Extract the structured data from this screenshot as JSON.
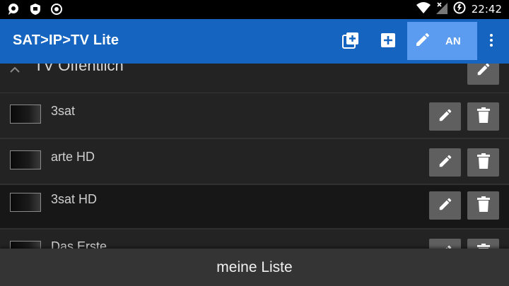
{
  "statusbar": {
    "time": "22:42",
    "icons": [
      "chat-bubble-icon",
      "shield-icon",
      "record-icon",
      "wifi-icon",
      "signal-off-icon",
      "data-saver-icon"
    ]
  },
  "appbar": {
    "title": "SAT>IP>TV Lite",
    "edit_toggle_label": "AN",
    "color": "#1565c0",
    "edit_active_color": "#5b9cf0",
    "icons": [
      "add-list-icon",
      "add-icon",
      "pencil-icon",
      "more-vert-icon"
    ]
  },
  "group": {
    "title": "TV Öffentlich"
  },
  "channels": [
    {
      "name": "3sat"
    },
    {
      "name": "arte HD"
    },
    {
      "name": "3sat HD"
    },
    {
      "name": "Das Erste"
    }
  ],
  "bottombar": {
    "label": "meine Liste"
  }
}
